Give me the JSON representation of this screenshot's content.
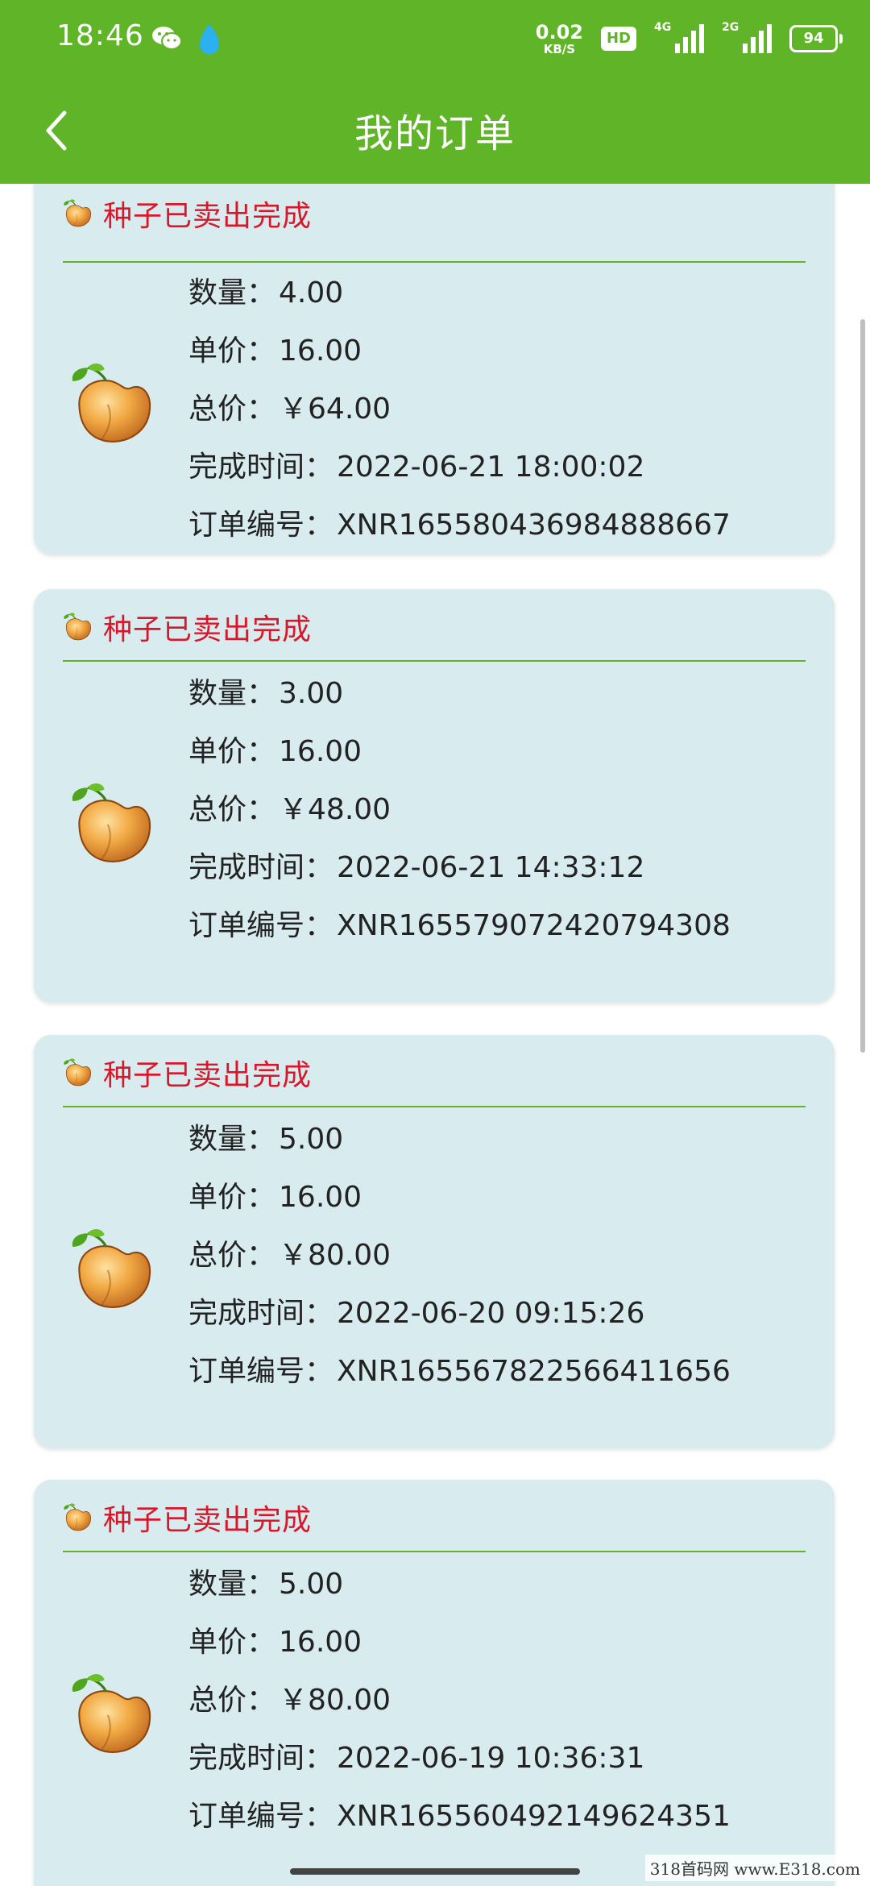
{
  "status_bar": {
    "time": "18:46",
    "net_speed_value": "0.02",
    "net_speed_unit": "KB/S",
    "hd_label": "HD",
    "signal1_label": "4G",
    "signal2_label": "2G",
    "battery": "94"
  },
  "nav": {
    "title": "我的订单",
    "back_icon": "chevron-left-icon"
  },
  "labels": {
    "quantity": "数量：",
    "unit_price": "单价：",
    "total": "总价：",
    "completed_at": "完成时间：",
    "order_no": "订单编号："
  },
  "orders": [
    {
      "status": "种子已卖出完成",
      "quantity": "4.00",
      "unit_price": "16.00",
      "total": "￥64.00",
      "completed_at": "2022-06-21 18:00:02",
      "order_no": "XNR165580436984888667"
    },
    {
      "status": "种子已卖出完成",
      "quantity": "3.00",
      "unit_price": "16.00",
      "total": "￥48.00",
      "completed_at": "2022-06-21 14:33:12",
      "order_no": "XNR165579072420794308"
    },
    {
      "status": "种子已卖出完成",
      "quantity": "5.00",
      "unit_price": "16.00",
      "total": "￥80.00",
      "completed_at": "2022-06-20 09:15:26",
      "order_no": "XNR165567822566411656"
    },
    {
      "status": "种子已卖出完成",
      "quantity": "5.00",
      "unit_price": "16.00",
      "total": "￥80.00",
      "completed_at": "2022-06-19 10:36:31",
      "order_no": "XNR165560492149624351"
    }
  ],
  "watermark": "318首码网 www.E318.com",
  "colors": {
    "header_green": "#5fb427",
    "card_bg": "#d8ebee",
    "status_red": "#d8172a"
  }
}
